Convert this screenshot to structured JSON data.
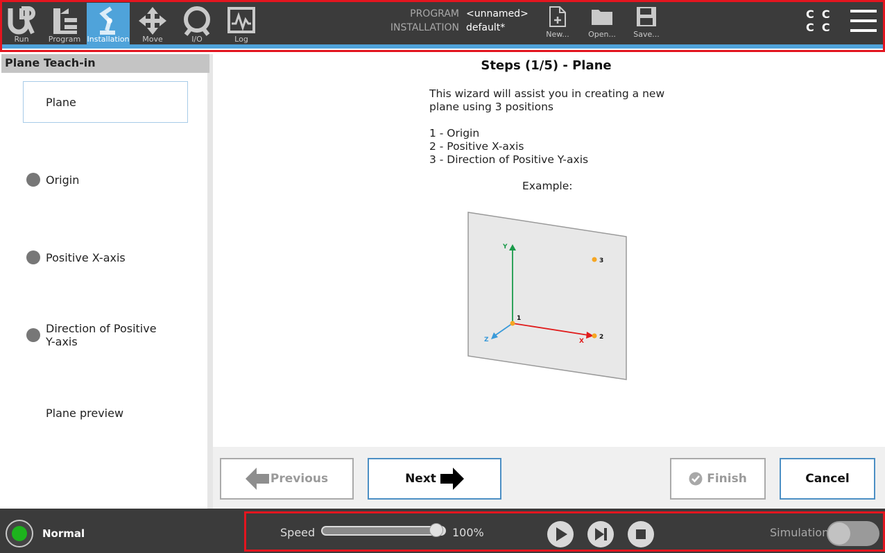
{
  "header": {
    "nav": [
      {
        "label": "Run",
        "icon": "ur-logo-icon",
        "active": false
      },
      {
        "label": "Program",
        "icon": "program-tree-icon",
        "active": false
      },
      {
        "label": "Installation",
        "icon": "robot-arm-icon",
        "active": true
      },
      {
        "label": "Move",
        "icon": "move-arrows-icon",
        "active": false
      },
      {
        "label": "I/O",
        "icon": "io-icon",
        "active": false
      },
      {
        "label": "Log",
        "icon": "log-chart-icon",
        "active": false
      }
    ],
    "program_label": "PROGRAM",
    "program_value": "<unnamed>",
    "installation_label": "INSTALLATION",
    "installation_value": "default*",
    "file_buttons": [
      {
        "label": "New...",
        "icon": "new-file-icon"
      },
      {
        "label": "Open...",
        "icon": "folder-icon"
      },
      {
        "label": "Save...",
        "icon": "floppy-disk-icon"
      }
    ],
    "cc_glyph": "C",
    "menu_icon": "hamburger-menu-icon",
    "accent_color": "#4fa3da"
  },
  "sidebar": {
    "title": "Plane Teach-in",
    "items": [
      {
        "label": "Plane",
        "selected": true
      },
      {
        "label": "Origin"
      },
      {
        "label": "Positive X-axis"
      },
      {
        "label": "Direction of Positive",
        "label2": "Y-axis"
      },
      {
        "label": "Plane preview"
      }
    ]
  },
  "main": {
    "title": "Steps (1/5) - Plane",
    "intro_line1": "This wizard will assist you in creating a new",
    "intro_line2": "plane using 3 positions",
    "steps": [
      "1 - Origin",
      "2 - Positive X-axis",
      "3 - Direction of Positive Y-axis"
    ],
    "example_label": "Example:",
    "diagram": {
      "y_axis": "Y",
      "x_axis": "X",
      "z_axis": "Z",
      "p1": "1",
      "p2": "2",
      "p3": "3",
      "x_color": "#e01b1b",
      "y_color": "#1a9a4a",
      "z_color": "#3a9ad9",
      "point_color": "#f5a623"
    }
  },
  "buttons": {
    "previous": "Previous",
    "next": "Next",
    "finish": "Finish",
    "cancel": "Cancel"
  },
  "footer": {
    "status": "Normal",
    "status_color": "#1db31d",
    "speed_label": "Speed",
    "speed_value": "100%",
    "speed_fraction": 1.0,
    "simulation_label": "Simulation",
    "simulation_on": false
  }
}
